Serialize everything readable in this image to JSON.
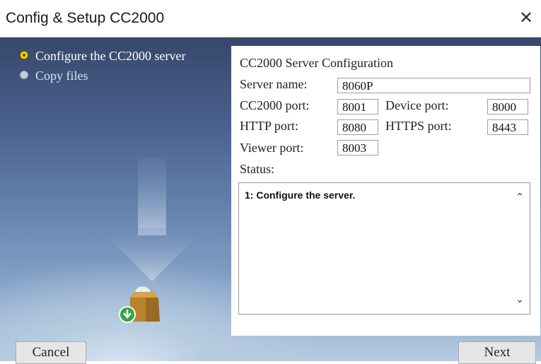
{
  "window": {
    "title": "Config & Setup CC2000",
    "close_glyph": "✕"
  },
  "steps": [
    {
      "label": "Configure the CC2000 server",
      "state": "active"
    },
    {
      "label": "Copy files",
      "state": "pending"
    }
  ],
  "panel": {
    "heading": "CC2000 Server Configuration",
    "server_name_label": "Server name:",
    "server_name_value": "8060P",
    "cc2000_port_label": "CC2000 port:",
    "cc2000_port_value": "8001",
    "device_port_label": "Device port:",
    "device_port_value": "8000",
    "http_port_label": "HTTP port:",
    "http_port_value": "8080",
    "https_port_label": "HTTPS port:",
    "https_port_value": "8443",
    "viewer_port_label": "Viewer port:",
    "viewer_port_value": "8003",
    "status_label": "Status:",
    "status_text": "1: Configure the server.",
    "scroll_up_glyph": "⌃",
    "scroll_down_glyph": "⌄"
  },
  "buttons": {
    "cancel": "Cancel",
    "next": "Next"
  },
  "colors": {
    "step_active": "#ffd600",
    "background_top": "#36486b",
    "background_bottom": "#b7cce2"
  },
  "icons": {
    "step_active": "yellow-bullet-icon",
    "step_pending": "gray-bullet-icon",
    "install": "install-box-icon"
  }
}
